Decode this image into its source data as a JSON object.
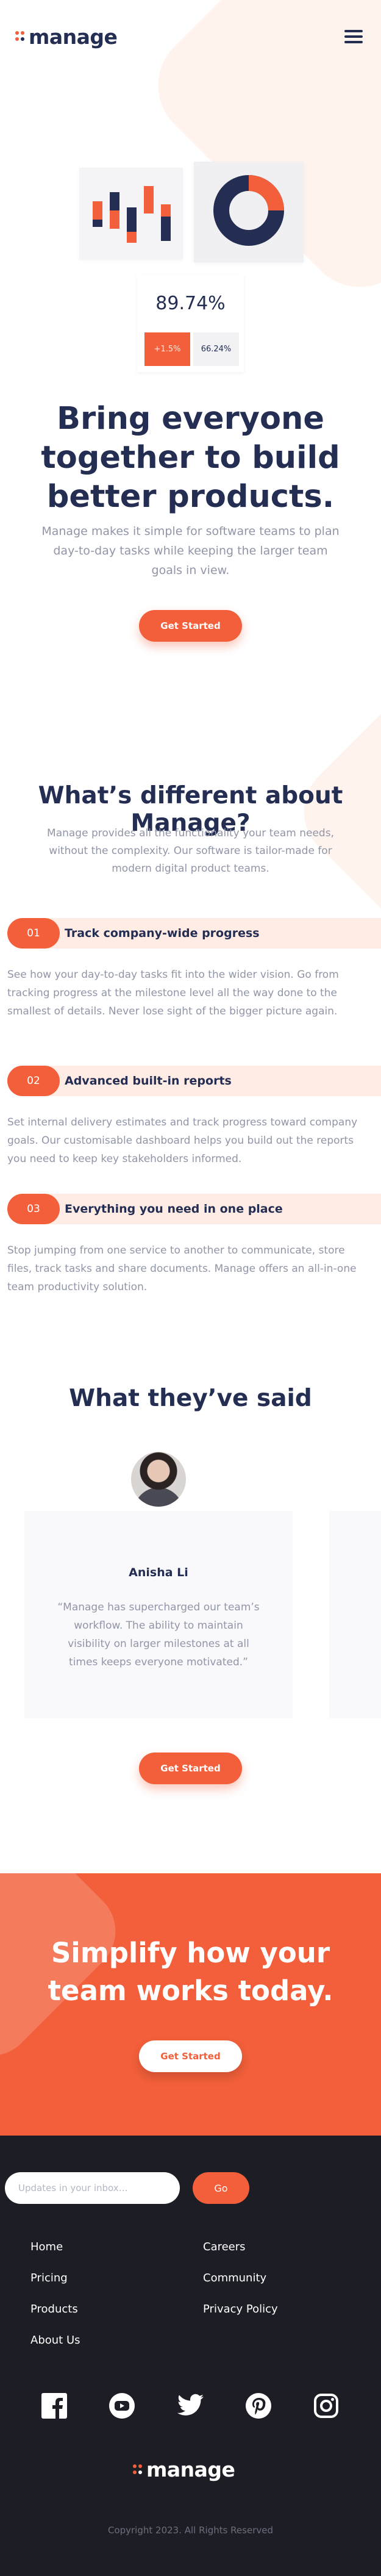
{
  "header": {
    "logo_text": "manage",
    "menu_icon": "hamburger-menu-icon"
  },
  "colors": {
    "accent": "#f25f3a",
    "navy": "#242d52",
    "muted": "#9095a7",
    "pale_accent": "#ffece5",
    "footer_bg": "#1d1e25"
  },
  "hero": {
    "illustration": {
      "stat_value": "89.74%",
      "stat_change": "+1.5%",
      "stat_secondary": "66.24%"
    },
    "title": "Bring everyone together to build better products.",
    "text": "Manage makes it simple for software teams to plan day-to-day tasks while keeping the larger team goals in view.",
    "cta_label": "Get Started"
  },
  "features": {
    "title": "What’s different about Manage?",
    "text": "Manage provides all the functionality your team needs, without the complexity. Our software is tailor-made for modern digital product teams.",
    "items": [
      {
        "number": "01",
        "title": "Track company-wide progress",
        "body": "See how your day-to-day tasks fit into the wider vision. Go from tracking progress at the milestone level all the way done to the smallest of details. Never lose sight of the bigger picture again."
      },
      {
        "number": "02",
        "title": "Advanced built-in reports",
        "body": "Set internal delivery estimates and track progress toward company goals. Our customisable dashboard helps you build out the reports you need to keep key stakeholders informed."
      },
      {
        "number": "03",
        "title": "Everything you need in one place",
        "body": "Stop jumping from one service to another to communicate, store files, track tasks and share documents. Manage offers an all-in-one team productivity solution."
      }
    ]
  },
  "testimonials": {
    "title": "What they’ve said",
    "items": [
      {
        "name": "Anisha Li",
        "quote": "“Manage has supercharged our team’s workflow. The ability to maintain visibility on larger milestones at all times keeps everyone motivated.”"
      }
    ],
    "cta_label": "Get Started"
  },
  "cta": {
    "title": "Simplify how your team works today.",
    "button_label": "Get Started"
  },
  "footer": {
    "newsletter_placeholder": "Updates in your inbox…",
    "go_label": "Go",
    "links_col1": [
      "Home",
      "Pricing",
      "Products",
      "About Us"
    ],
    "links_col2": [
      "Careers",
      "Community",
      "Privacy Policy"
    ],
    "social_icons": [
      "facebook-icon",
      "youtube-icon",
      "twitter-icon",
      "pinterest-icon",
      "instagram-icon"
    ],
    "logo_text": "manage",
    "copyright": "Copyright 2023. All Rights Reserved"
  }
}
